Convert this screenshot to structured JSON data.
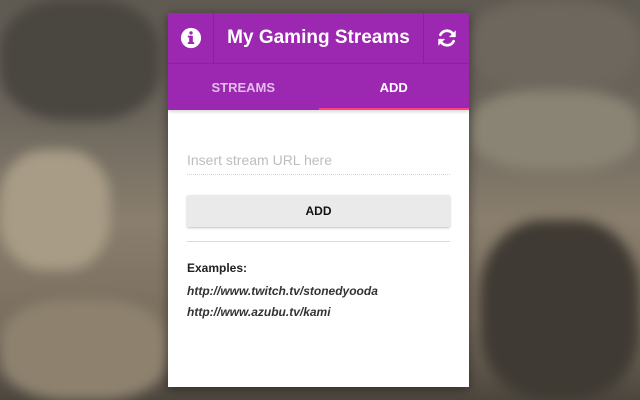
{
  "header": {
    "title": "My Gaming Streams",
    "info_icon": "info-circle-icon",
    "refresh_icon": "refresh-icon"
  },
  "tabs": [
    {
      "label": "STREAMS",
      "active": false
    },
    {
      "label": "ADD",
      "active": true
    }
  ],
  "add_form": {
    "url_input_value": "",
    "url_input_placeholder": "Insert stream URL here",
    "add_button_label": "ADD"
  },
  "examples": {
    "title": "Examples:",
    "links": [
      "http://www.twitch.tv/stonedyooda",
      "http://www.azubu.tv/kami"
    ]
  },
  "colors": {
    "header_bg": "#9c27b0",
    "tab_indicator": "#ff4081",
    "button_bg": "#eaeaea"
  }
}
